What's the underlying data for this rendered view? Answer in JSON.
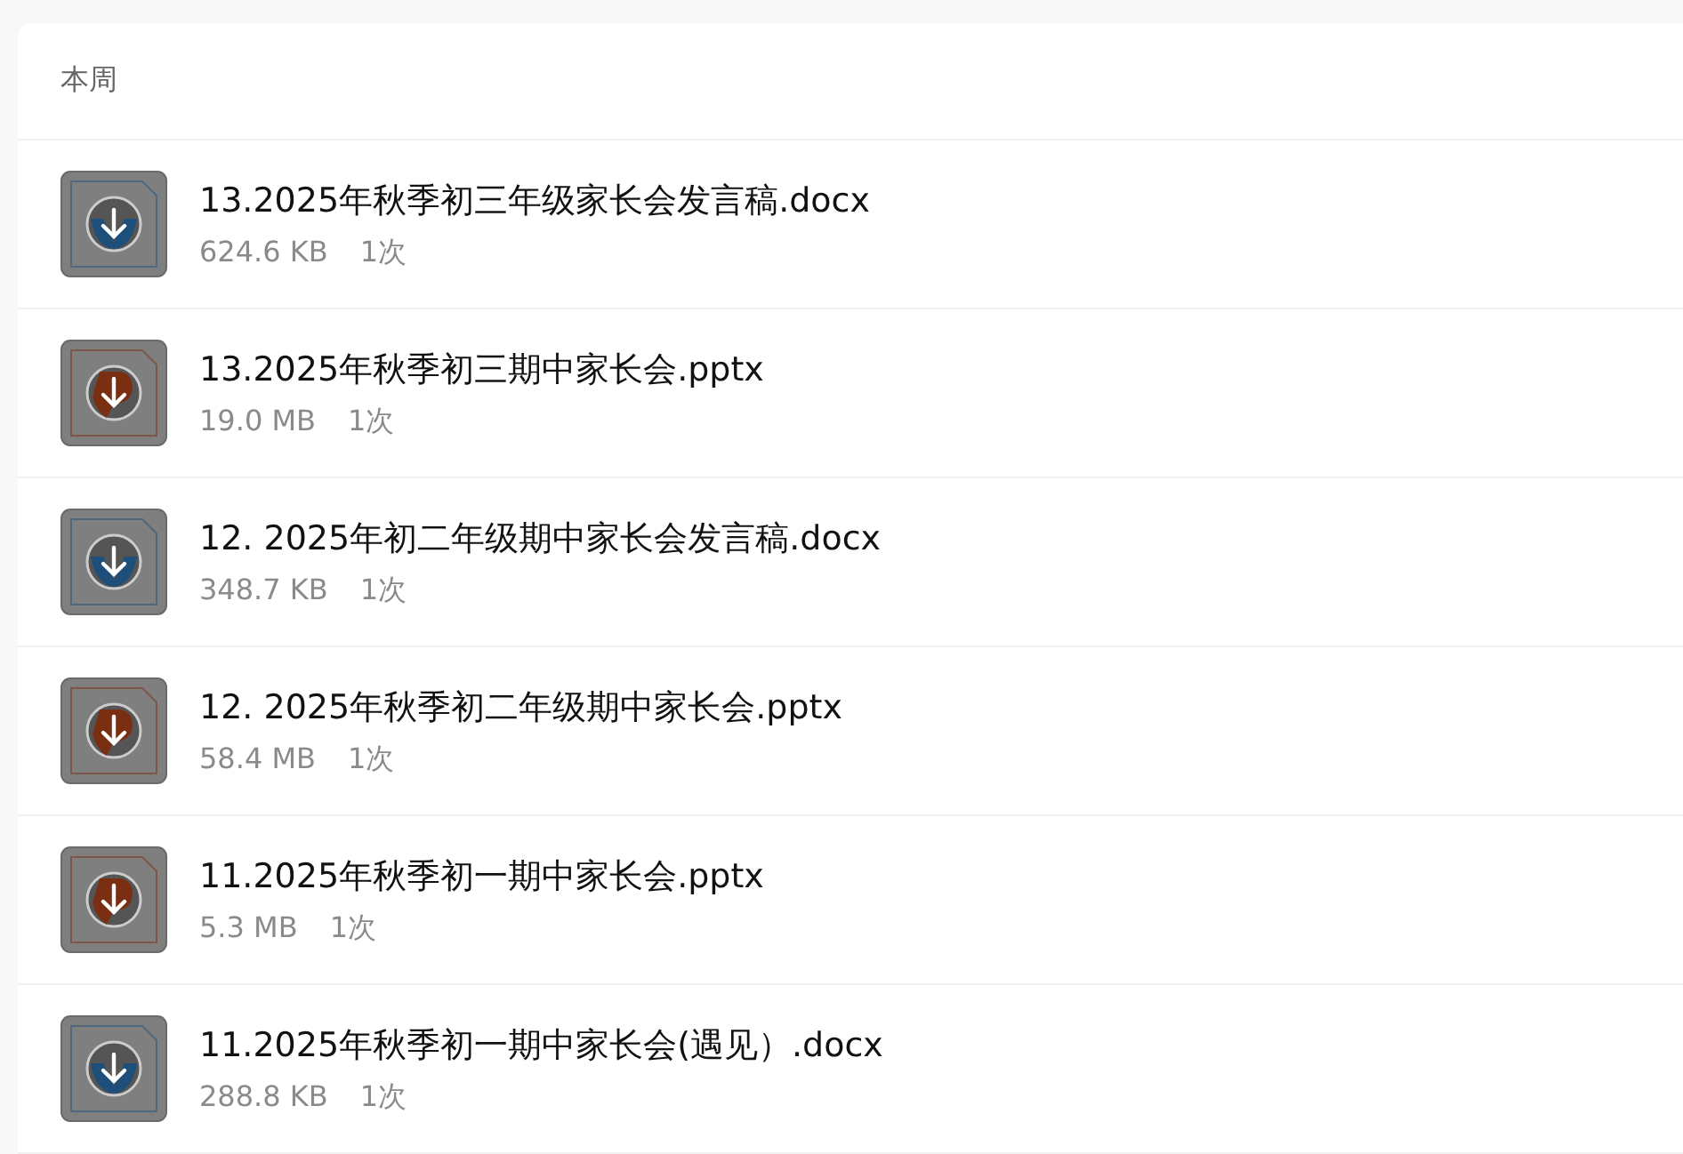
{
  "section": {
    "title": "本周"
  },
  "files": [
    {
      "name": "13.2025年秋季初三年级家长会发言稿.docx",
      "size": "624.6 KB",
      "count": "1次",
      "kind": "docx"
    },
    {
      "name": "13.2025年秋季初三期中家长会.pptx",
      "size": "19.0 MB",
      "count": "1次",
      "kind": "pptx"
    },
    {
      "name": "12. 2025年初二年级期中家长会发言稿.docx",
      "size": "348.7 KB",
      "count": "1次",
      "kind": "docx"
    },
    {
      "name": "12. 2025年秋季初二年级期中家长会.pptx",
      "size": "58.4 MB",
      "count": "1次",
      "kind": "pptx"
    },
    {
      "name": "11.2025年秋季初一期中家长会.pptx",
      "size": "5.3 MB",
      "count": "1次",
      "kind": "pptx"
    },
    {
      "name": "11.2025年秋季初一期中家长会(遇见）.docx",
      "size": "288.8 KB",
      "count": "1次",
      "kind": "docx"
    }
  ]
}
